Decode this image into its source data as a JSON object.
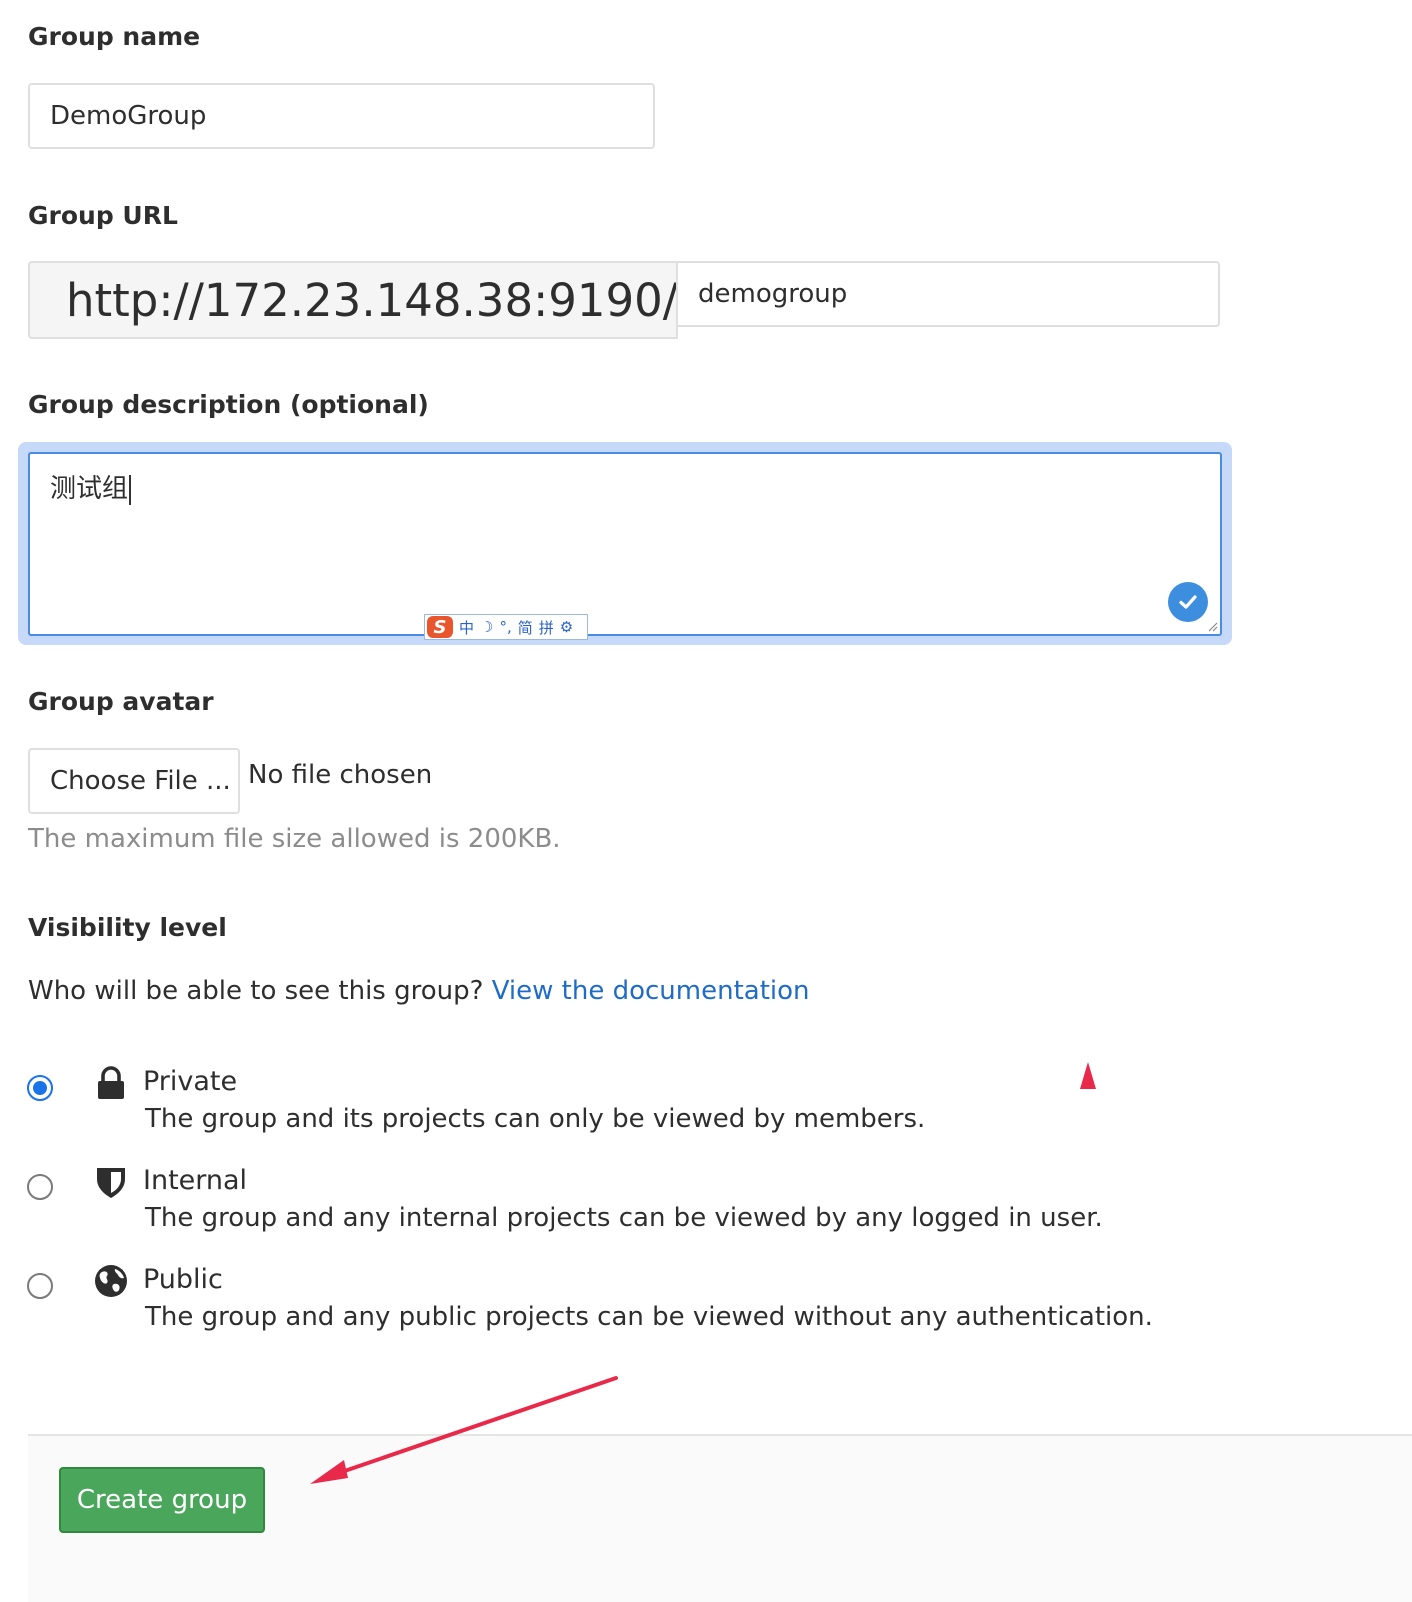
{
  "group_name": {
    "label": "Group name",
    "value": "DemoGroup"
  },
  "group_url": {
    "label": "Group URL",
    "prefix": "http://172.23.148.38:9190/",
    "path_value": "demogroup"
  },
  "group_description": {
    "label": "Group description (optional)",
    "value": "测试组",
    "ime_toolbar": {
      "logo": "S",
      "items": [
        "中",
        "☽",
        "°,",
        "简",
        "拼",
        "⚙"
      ]
    }
  },
  "group_avatar": {
    "label": "Group avatar",
    "choose_button": "Choose File ...",
    "status": "No file chosen",
    "help": "The maximum file size allowed is 200KB."
  },
  "visibility": {
    "label": "Visibility level",
    "question": "Who will be able to see this group?",
    "doc_link": "View the documentation",
    "selected": "private",
    "options": [
      {
        "title": "Private",
        "description": "The group and its projects can only be viewed by members.",
        "icon": "lock-icon"
      },
      {
        "title": "Internal",
        "description": "The group and any internal projects can be viewed by any logged in user.",
        "icon": "shield-icon"
      },
      {
        "title": "Public",
        "description": "The group and any public projects can be viewed without any authentication.",
        "icon": "globe-icon"
      }
    ]
  },
  "footer": {
    "create_button": "Create group"
  },
  "colors": {
    "primary_button": "#4aa65a",
    "link": "#1f6cc7",
    "focus_ring": "#c7d9f8",
    "annotation_arrow": "#e8294a"
  }
}
